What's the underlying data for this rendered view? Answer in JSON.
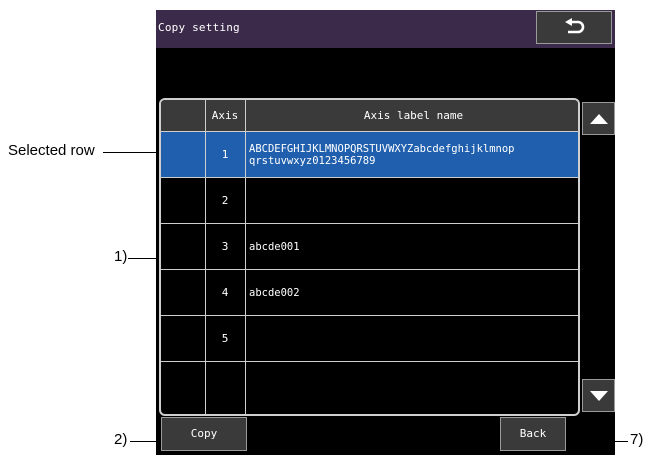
{
  "window": {
    "title": "Copy setting"
  },
  "table": {
    "headers": {
      "axis": "Axis",
      "name": "Axis label name"
    },
    "rows": [
      {
        "axis": "1",
        "name_line1": "ABCDEFGHIJKLMNOPQRSTUVWXYZabcdefghijklmnop",
        "name_line2": "qrstuvwxyz0123456789",
        "selected": true
      },
      {
        "axis": "2",
        "name_line1": "",
        "name_line2": "",
        "selected": false
      },
      {
        "axis": "3",
        "name_line1": "abcde001",
        "name_line2": "",
        "selected": false
      },
      {
        "axis": "4",
        "name_line1": "abcde002",
        "name_line2": "",
        "selected": false
      },
      {
        "axis": "5",
        "name_line1": "",
        "name_line2": "",
        "selected": false
      },
      {
        "axis": "",
        "name_line1": "",
        "name_line2": "",
        "selected": false
      }
    ]
  },
  "buttons": {
    "copy": "Copy",
    "back": "Back"
  },
  "callouts": {
    "selected_row": "Selected row",
    "c1": "1)",
    "c2": "2)",
    "c7": "7)"
  },
  "icons": {
    "return": "return-arrow-icon",
    "scroll_up": "triangle-up-icon",
    "scroll_down": "triangle-down-icon"
  },
  "colors": {
    "screen_bg": "#000000",
    "title_bar": "#3c2a4a",
    "selected_row": "#1f5fad",
    "grid": "#cfcfcf"
  }
}
